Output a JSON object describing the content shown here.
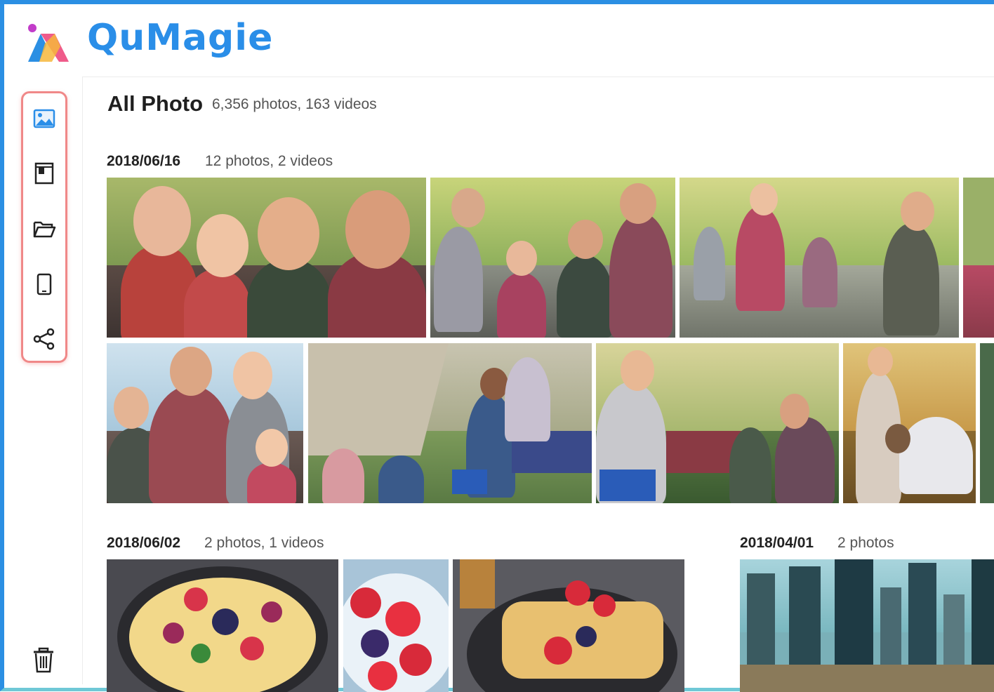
{
  "app": {
    "name": "QuMagie"
  },
  "colors": {
    "brand": "#2a8ee8",
    "frame": "#2b8fe3",
    "nav_highlight": "#f08888"
  },
  "header": {
    "title": "All Photo",
    "subtitle": "6,356 photos, 163 videos"
  },
  "sidebar": {
    "items": [
      {
        "icon": "photo-icon",
        "active": true
      },
      {
        "icon": "album-icon"
      },
      {
        "icon": "folder-icon"
      },
      {
        "icon": "device-icon"
      },
      {
        "icon": "share-icon"
      }
    ],
    "bottom_icon": "trash-icon"
  },
  "groups": [
    {
      "date": "2018/06/16",
      "count": "12 photos, 2 videos"
    },
    {
      "date": "2018/06/02",
      "count": "2 photos, 1 videos"
    },
    {
      "date": "2018/04/01",
      "count": "2 photos"
    }
  ]
}
